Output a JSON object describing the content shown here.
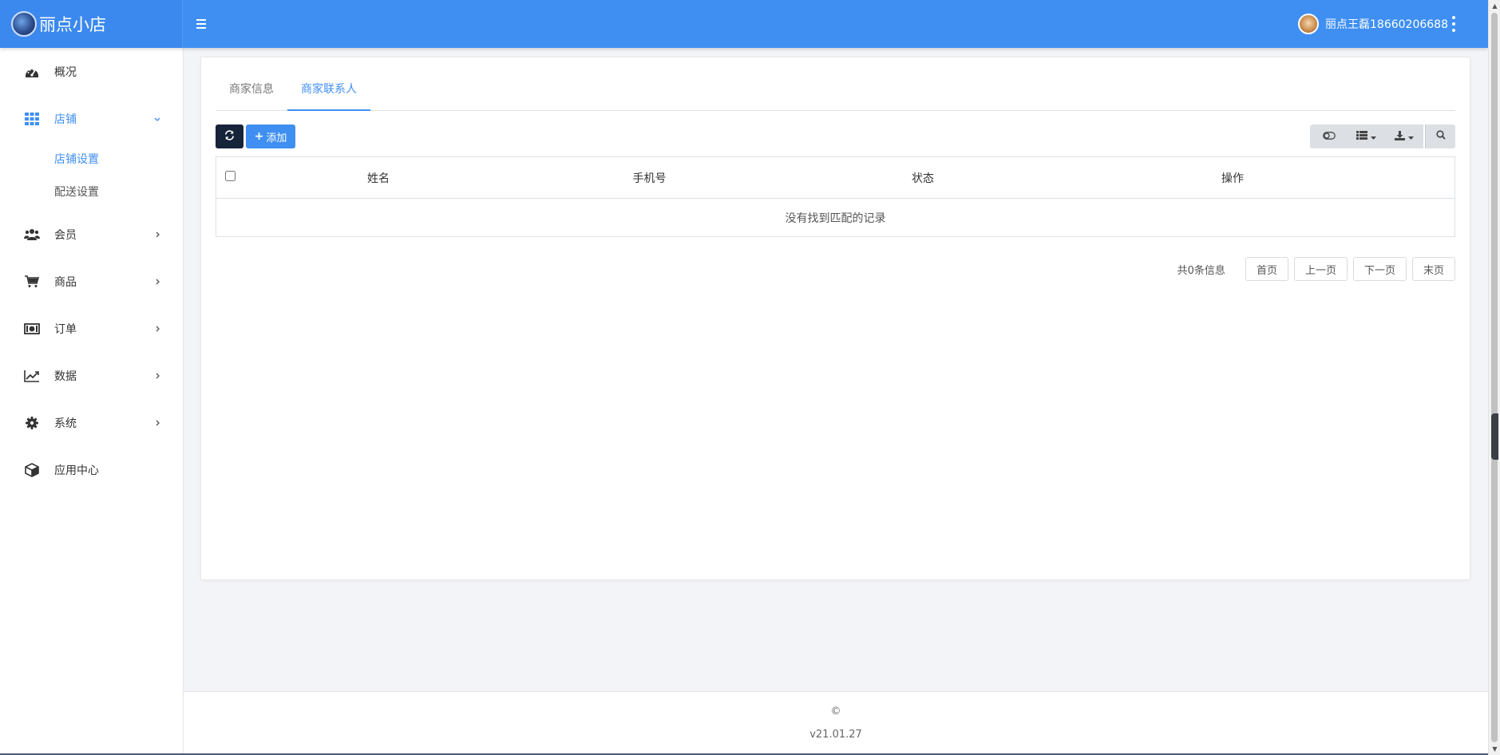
{
  "header": {
    "brand_name": "丽点小店",
    "user_name": "丽点王磊18660206688"
  },
  "sidebar": {
    "items": [
      {
        "label": "概况",
        "icon": "dashboard-icon"
      },
      {
        "label": "店铺",
        "icon": "grid-icon",
        "expanded": true,
        "sub": [
          "店铺设置",
          "配送设置"
        ]
      },
      {
        "label": "会员",
        "icon": "users-icon"
      },
      {
        "label": "商品",
        "icon": "cart-icon"
      },
      {
        "label": "订单",
        "icon": "money-icon"
      },
      {
        "label": "数据",
        "icon": "line-chart-icon"
      },
      {
        "label": "系统",
        "icon": "gear-icon"
      },
      {
        "label": "应用中心",
        "icon": "cube-icon"
      }
    ]
  },
  "tabs": [
    "商家信息",
    "商家联系人"
  ],
  "active_tab": "商家联系人",
  "toolbar": {
    "add_label": "添加"
  },
  "table": {
    "columns": [
      "姓名",
      "手机号",
      "状态",
      "操作"
    ],
    "empty_text": "没有找到匹配的记录"
  },
  "pagination": {
    "total_text": "共0条信息",
    "first": "首页",
    "prev": "上一页",
    "next": "下一页",
    "last": "末页"
  },
  "footer": {
    "copyright": "©",
    "version": "v21.01.27"
  },
  "colors": {
    "primary": "#3f8ff2",
    "dark_button": "#162338",
    "background": "#f3f4f7"
  }
}
